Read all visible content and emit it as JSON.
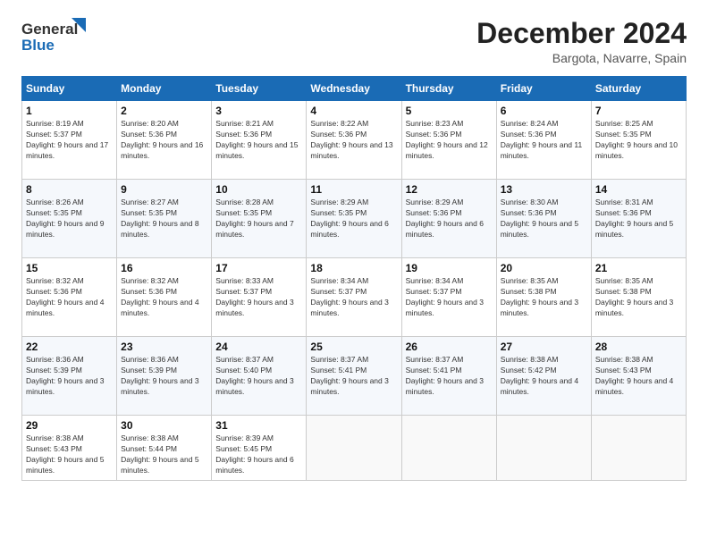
{
  "header": {
    "logo_line1": "General",
    "logo_line2": "Blue",
    "month": "December 2024",
    "location": "Bargota, Navarre, Spain"
  },
  "weekdays": [
    "Sunday",
    "Monday",
    "Tuesday",
    "Wednesday",
    "Thursday",
    "Friday",
    "Saturday"
  ],
  "weeks": [
    [
      {
        "day": 1,
        "info": "Sunrise: 8:19 AM\nSunset: 5:37 PM\nDaylight: 9 hours and 17 minutes."
      },
      {
        "day": 2,
        "info": "Sunrise: 8:20 AM\nSunset: 5:36 PM\nDaylight: 9 hours and 16 minutes."
      },
      {
        "day": 3,
        "info": "Sunrise: 8:21 AM\nSunset: 5:36 PM\nDaylight: 9 hours and 15 minutes."
      },
      {
        "day": 4,
        "info": "Sunrise: 8:22 AM\nSunset: 5:36 PM\nDaylight: 9 hours and 13 minutes."
      },
      {
        "day": 5,
        "info": "Sunrise: 8:23 AM\nSunset: 5:36 PM\nDaylight: 9 hours and 12 minutes."
      },
      {
        "day": 6,
        "info": "Sunrise: 8:24 AM\nSunset: 5:36 PM\nDaylight: 9 hours and 11 minutes."
      },
      {
        "day": 7,
        "info": "Sunrise: 8:25 AM\nSunset: 5:35 PM\nDaylight: 9 hours and 10 minutes."
      }
    ],
    [
      {
        "day": 8,
        "info": "Sunrise: 8:26 AM\nSunset: 5:35 PM\nDaylight: 9 hours and 9 minutes."
      },
      {
        "day": 9,
        "info": "Sunrise: 8:27 AM\nSunset: 5:35 PM\nDaylight: 9 hours and 8 minutes."
      },
      {
        "day": 10,
        "info": "Sunrise: 8:28 AM\nSunset: 5:35 PM\nDaylight: 9 hours and 7 minutes."
      },
      {
        "day": 11,
        "info": "Sunrise: 8:29 AM\nSunset: 5:35 PM\nDaylight: 9 hours and 6 minutes."
      },
      {
        "day": 12,
        "info": "Sunrise: 8:29 AM\nSunset: 5:36 PM\nDaylight: 9 hours and 6 minutes."
      },
      {
        "day": 13,
        "info": "Sunrise: 8:30 AM\nSunset: 5:36 PM\nDaylight: 9 hours and 5 minutes."
      },
      {
        "day": 14,
        "info": "Sunrise: 8:31 AM\nSunset: 5:36 PM\nDaylight: 9 hours and 5 minutes."
      }
    ],
    [
      {
        "day": 15,
        "info": "Sunrise: 8:32 AM\nSunset: 5:36 PM\nDaylight: 9 hours and 4 minutes."
      },
      {
        "day": 16,
        "info": "Sunrise: 8:32 AM\nSunset: 5:36 PM\nDaylight: 9 hours and 4 minutes."
      },
      {
        "day": 17,
        "info": "Sunrise: 8:33 AM\nSunset: 5:37 PM\nDaylight: 9 hours and 3 minutes."
      },
      {
        "day": 18,
        "info": "Sunrise: 8:34 AM\nSunset: 5:37 PM\nDaylight: 9 hours and 3 minutes."
      },
      {
        "day": 19,
        "info": "Sunrise: 8:34 AM\nSunset: 5:37 PM\nDaylight: 9 hours and 3 minutes."
      },
      {
        "day": 20,
        "info": "Sunrise: 8:35 AM\nSunset: 5:38 PM\nDaylight: 9 hours and 3 minutes."
      },
      {
        "day": 21,
        "info": "Sunrise: 8:35 AM\nSunset: 5:38 PM\nDaylight: 9 hours and 3 minutes."
      }
    ],
    [
      {
        "day": 22,
        "info": "Sunrise: 8:36 AM\nSunset: 5:39 PM\nDaylight: 9 hours and 3 minutes."
      },
      {
        "day": 23,
        "info": "Sunrise: 8:36 AM\nSunset: 5:39 PM\nDaylight: 9 hours and 3 minutes."
      },
      {
        "day": 24,
        "info": "Sunrise: 8:37 AM\nSunset: 5:40 PM\nDaylight: 9 hours and 3 minutes."
      },
      {
        "day": 25,
        "info": "Sunrise: 8:37 AM\nSunset: 5:41 PM\nDaylight: 9 hours and 3 minutes."
      },
      {
        "day": 26,
        "info": "Sunrise: 8:37 AM\nSunset: 5:41 PM\nDaylight: 9 hours and 3 minutes."
      },
      {
        "day": 27,
        "info": "Sunrise: 8:38 AM\nSunset: 5:42 PM\nDaylight: 9 hours and 4 minutes."
      },
      {
        "day": 28,
        "info": "Sunrise: 8:38 AM\nSunset: 5:43 PM\nDaylight: 9 hours and 4 minutes."
      }
    ],
    [
      {
        "day": 29,
        "info": "Sunrise: 8:38 AM\nSunset: 5:43 PM\nDaylight: 9 hours and 5 minutes."
      },
      {
        "day": 30,
        "info": "Sunrise: 8:38 AM\nSunset: 5:44 PM\nDaylight: 9 hours and 5 minutes."
      },
      {
        "day": 31,
        "info": "Sunrise: 8:39 AM\nSunset: 5:45 PM\nDaylight: 9 hours and 6 minutes."
      },
      null,
      null,
      null,
      null
    ]
  ]
}
